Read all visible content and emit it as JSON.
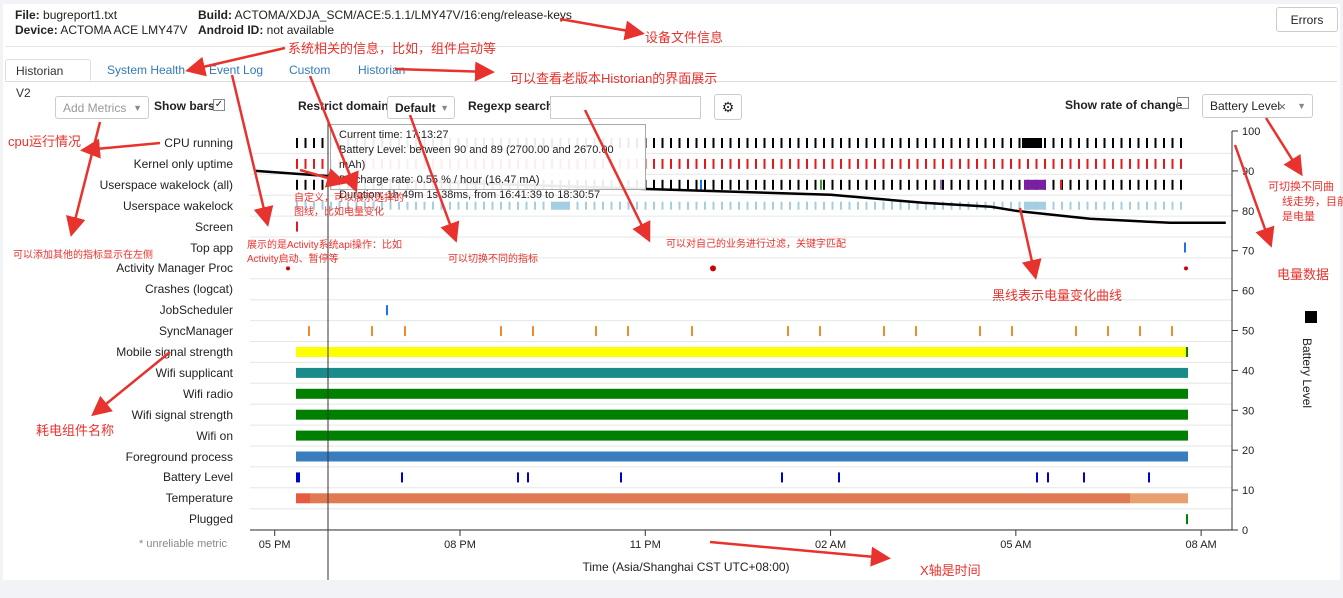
{
  "header": {
    "file_label": "File:",
    "file_value": "bugreport1.txt",
    "device_label": "Device:",
    "device_value": "ACTOMA ACE LMY47V",
    "build_label": "Build:",
    "build_value": "ACTOMA/XDJA_SCM/ACE:5.1.1/LMY47V/16:eng/release-keys",
    "androidid_label": "Android ID:",
    "androidid_value": "not available",
    "errors_button": "Errors"
  },
  "tabs": [
    {
      "label": "Historian V2",
      "active": true
    },
    {
      "label": "System Health"
    },
    {
      "label": "Event Log"
    },
    {
      "label": "Custom"
    },
    {
      "label": "Historian"
    }
  ],
  "controls": {
    "add_metrics_placeholder": "Add Metrics",
    "show_bars_label": "Show bars",
    "show_bars_checked": true,
    "restrict_domain_label": "Restrict domain",
    "restrict_domain_value": "Default",
    "regexp_search_label": "Regexp search",
    "regexp_value": "",
    "show_rate_label": "Show rate of change",
    "show_rate_checked": false,
    "metric_select_value": "Battery Level",
    "clear_icon": "×",
    "settings_icon": "gear-icon"
  },
  "metrics": [
    "CPU running",
    "Kernel only uptime",
    "Userspace wakelock (all)",
    "Userspace wakelock",
    "Screen",
    "Top app",
    "Activity Manager Proc",
    "Crashes (logcat)",
    "JobScheduler",
    "SyncManager",
    "Mobile signal strength",
    "Wifi supplicant",
    "Wifi radio",
    "Wifi signal strength",
    "Wifi on",
    "Foreground process",
    "Battery Level",
    "Temperature",
    "Plugged"
  ],
  "unreliable_note": "* unreliable metric",
  "tooltip": {
    "line1": "Current time: 17:13:27",
    "line2": "Battery Level: between 90 and 89 (2700.00 and 2670.00 mAh)",
    "line3": "Discharge rate: 0.55 % / hour (16.47 mA)",
    "line4": "Duration: 1h 49m 1s 38ms, from 16:41:39 to 18:30:57"
  },
  "chart_data": {
    "type": "timeline",
    "xlabel": "Time (Asia/Shanghai CST UTC+08:00)",
    "x_ticks": [
      "05 PM",
      "08 PM",
      "11 PM",
      "02 AM",
      "05 AM",
      "08 AM"
    ],
    "ylabel": "Battery Level",
    "ylim": [
      0,
      100
    ],
    "y_ticks": [
      0,
      10,
      20,
      30,
      40,
      50,
      60,
      70,
      80,
      90,
      100
    ],
    "x_hours_visible": [
      16.6,
      32.5
    ],
    "battery_level": {
      "x_hours": [
        16.69,
        18.5,
        20.0,
        22.0,
        24.0,
        26.0,
        27.5,
        28.6,
        29.0,
        30.2,
        31.5,
        32.4
      ],
      "y": [
        90,
        88,
        87,
        86,
        85,
        84,
        82,
        81,
        80,
        78,
        77,
        77
      ]
    },
    "colors": {
      "cpu": "#000000",
      "kernel": "#e31a1c",
      "wakelock": "#a6cee3",
      "mobile_signal": "#ffff00",
      "wifi_supplicant": "#1a8a8a",
      "wifi_green": "#008000",
      "foreground": "#3a7dbf",
      "battery_bar": "#0000cc",
      "temperature": "#e07a52",
      "sync": "#f08a30",
      "crash_dot": "#d00000"
    }
  },
  "annotations": {
    "device_info": "设备文件信息",
    "system_info": "系统相关的信息，比如，组件启动等",
    "old_historian": "可以查看老版本Historian的界面展示",
    "cpu_status": "cpu运行情况",
    "add_metrics": "可以添加其他的指标显示在左侧",
    "activity_ops_1": "展示的是Activity系统api操作：比如",
    "activity_ops_2": "Activity启动、暂停等",
    "custom_1": "自定义，可以展示选择的",
    "custom_2": "图线，比如电量变化",
    "switch_metric": "可以切换不同的指标",
    "filter": "可以对自己的业务进行过滤，关键字匹配",
    "battery_curve": "黑线表示电量变化曲线",
    "switch_curve_1": "可切换不同曲",
    "switch_curve_2": "线走势，目前",
    "switch_curve_3": "是电量",
    "battery_data": "电量数据",
    "component_names": "耗电组件名称",
    "x_axis_time": "X轴是时间"
  }
}
